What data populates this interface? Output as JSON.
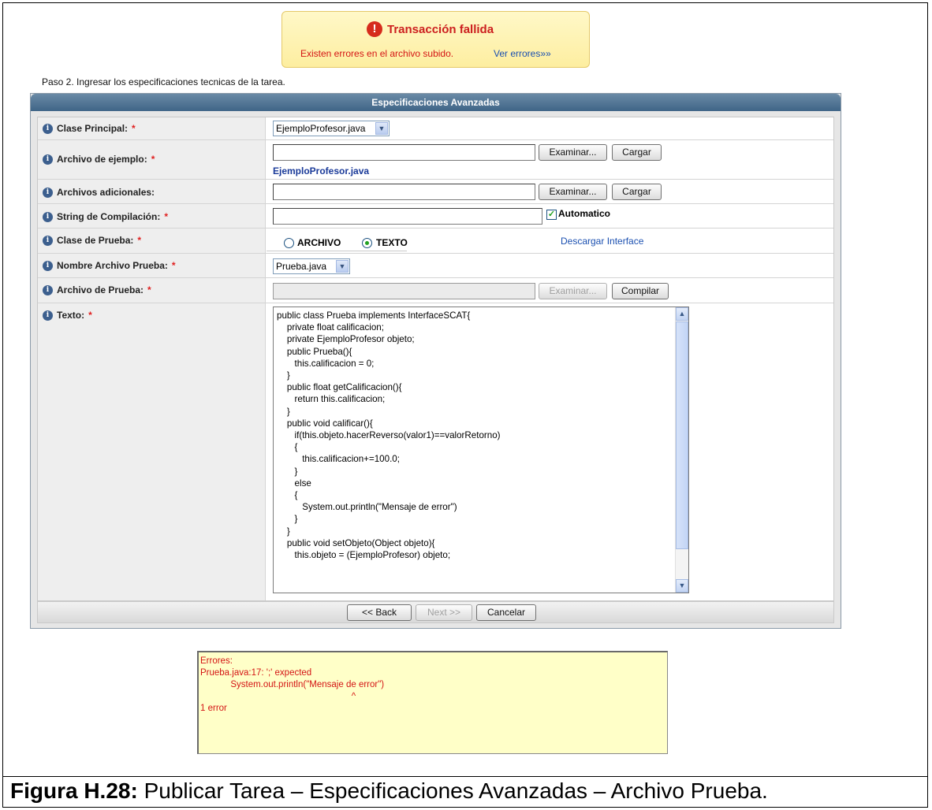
{
  "alert": {
    "title": "Transacción fallida",
    "icon": "exclamation-icon",
    "message": "Existen errores en el archivo subido.",
    "link": "Ver errores»»"
  },
  "step_text": "Paso 2. Ingresar los especificaciones tecnicas de la tarea.",
  "panel": {
    "title": "Especificaciones Avanzadas",
    "required_mark": "*",
    "rows": {
      "clase_principal": {
        "label": "Clase Principal:",
        "value": "EjemploProfesor.java"
      },
      "archivo_ejemplo": {
        "label": "Archivo de ejemplo:",
        "input_value": "",
        "browse": "Examinar...",
        "upload": "Cargar",
        "file_link": "EjemploProfesor.java"
      },
      "archivos_adicionales": {
        "label": "Archivos adicionales:",
        "input_value": "",
        "browse": "Examinar...",
        "upload": "Cargar"
      },
      "string_compilacion": {
        "label": "String de Compilación:",
        "input_value": "",
        "checkbox_label": "Automatico",
        "checked": true
      },
      "clase_prueba": {
        "label": "Clase de Prueba:",
        "option_archivo": "ARCHIVO",
        "option_texto": "TEXTO",
        "selected": "TEXTO",
        "link": "Descargar Interface"
      },
      "nombre_archivo_prueba": {
        "label": "Nombre Archivo Prueba:",
        "value": "Prueba.java"
      },
      "archivo_prueba": {
        "label": "Archivo de Prueba:",
        "input_value": "",
        "browse": "Examinar...",
        "compile": "Compilar"
      },
      "texto": {
        "label": "Texto:",
        "code": "public class Prueba implements InterfaceSCAT{\n    private float calificacion;\n    private EjemploProfesor objeto;\n    public Prueba(){\n       this.calificacion = 0;\n    }\n    public float getCalificacion(){\n       return this.calificacion;\n    }\n    public void calificar(){\n       if(this.objeto.hacerReverso(valor1)==valorRetorno)\n       {\n          this.calificacion+=100.0;\n       }\n       else\n       {\n          System.out.println(\"Mensaje de error\")\n       }\n    }\n    public void setObjeto(Object objeto){\n       this.objeto = (EjemploProfesor) objeto;"
      }
    },
    "nav": {
      "back": "<< Back",
      "next": "Next >>",
      "cancel": "Cancelar"
    }
  },
  "errors_text": "Errores:\nPrueba.java:17: ';' expected\n            System.out.println(\"Mensaje de error\")\n                                                            ^\n1 error",
  "caption": {
    "prefix": "Figura H.28:",
    "text": " Publicar Tarea – Especificaciones Avanzadas – Archivo Prueba."
  }
}
